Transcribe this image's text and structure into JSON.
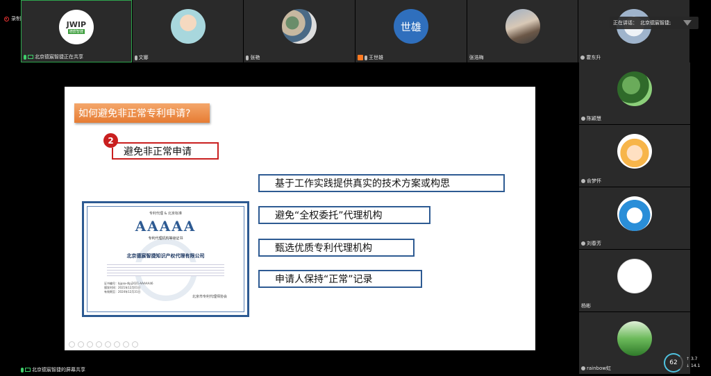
{
  "recording": {
    "label": "录制中"
  },
  "speaking": {
    "prefix": "正在讲话：",
    "name": "北京德宸智捷;"
  },
  "top_participants": [
    {
      "name": "北京德宸智捷正在共享",
      "avatar": "jwip-logo",
      "logo_text": "JWIP",
      "logo_tag": "德宸智捷"
    },
    {
      "name": "文娜",
      "avatar": "cartoon"
    },
    {
      "name": "张艳",
      "avatar": "painting"
    },
    {
      "name": "王世雄",
      "avatar": "text",
      "avatar_text": "世雄"
    },
    {
      "name": "张浩梅",
      "avatar": "photo"
    },
    {
      "name": "霍东升",
      "avatar": "flower"
    }
  ],
  "right_participants": [
    {
      "name": "陈颖慧",
      "avatar": "leaf"
    },
    {
      "name": "俞梦怀",
      "avatar": "orange"
    },
    {
      "name": "刘春芳",
      "avatar": "doraemon"
    },
    {
      "name": "杨彬",
      "avatar": "sketch"
    },
    {
      "name": "rainbow虹",
      "avatar": "grass"
    }
  ],
  "stage": {
    "label": "北京德宸智捷的屏幕共享"
  },
  "slide": {
    "title": "如何避免非正常专利申请?",
    "step_number": "2",
    "step_title": "避免非正常申请",
    "points": [
      "基于工作实践提供真实的技术方案或构思",
      "避免“全权委托”代理机构",
      "甄选优质专利代理机构",
      "申请人保持“正常”记录"
    ],
    "certificate": {
      "header": "专利代理  &  北京标准",
      "grade": "AAAAA",
      "subtitle": "专利代理机构等级证书",
      "company": "北京德宸智捷知识产权代理有限公司",
      "meta": [
        "证书编号：bjpaa-dlpj2021-AAAAA46",
        "颁发时间：2021年12月01日",
        "有效期至：2024年12月31日"
      ],
      "issuer": "北京市专利代理师协会"
    }
  },
  "network": {
    "quality": "62",
    "up": "3.7",
    "down": "14.1"
  }
}
